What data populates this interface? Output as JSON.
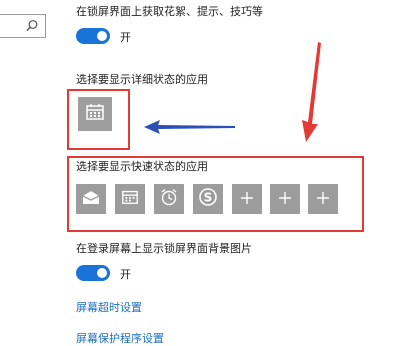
{
  "lock_screen": {
    "fun_facts_label": "在锁屏界面上获取花絮、提示、技巧等",
    "fun_facts_toggle": "开",
    "detailed_status_label": "选择要显示详细状态的应用",
    "quick_status_label": "选择要显示快速状态的应用",
    "quick_status_apps": [
      {
        "icon": "mail-icon"
      },
      {
        "icon": "calendar-icon"
      },
      {
        "icon": "alarm-icon"
      },
      {
        "icon": "skype-icon"
      },
      {
        "icon": "plus-icon"
      },
      {
        "icon": "plus-icon"
      },
      {
        "icon": "plus-icon"
      }
    ],
    "background_on_signin_label": "在登录屏幕上显示锁屏界面背景图片",
    "background_on_signin_toggle": "开",
    "timeout_link": "屏幕超时设置",
    "screensaver_link": "屏幕保护程序设置"
  },
  "colors": {
    "accent": "#1a73d6",
    "tile": "#9c9c9c",
    "annotation_red": "#e53935",
    "annotation_blue": "#2c4fb8",
    "link": "#1e6fbf"
  }
}
